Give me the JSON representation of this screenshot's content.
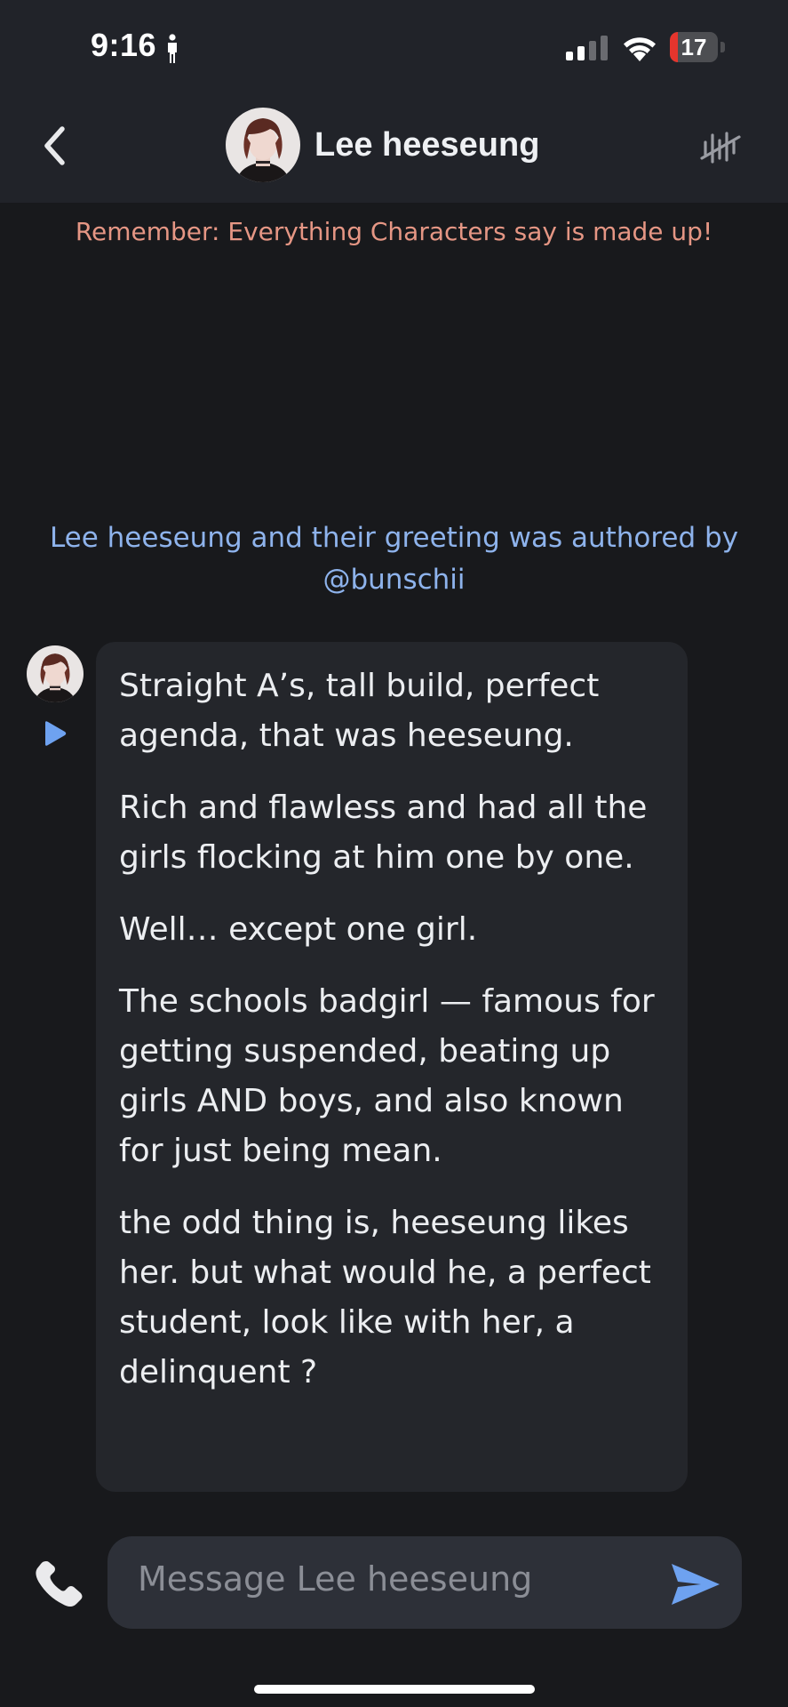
{
  "status_bar": {
    "time": "9:16",
    "battery_level": "17",
    "battery_fraction": 0.17,
    "icons": [
      "person-icon",
      "signal-icon",
      "wifi-icon",
      "battery-icon"
    ]
  },
  "header": {
    "title": "Lee heeseung",
    "icons": [
      "back-chevron-icon",
      "avatar",
      "mute-audio-icon"
    ]
  },
  "disclaimer": "Remember: Everything Characters say is made up!",
  "attribution": "Lee heeseung and their greeting was authored by @bunschii",
  "message": {
    "paragraphs": [
      "Straight A’s, tall build, perfect agenda, that was heeseung.",
      "Rich and flawless and had all the girls flocking at him one by one.",
      "Well… except one girl.",
      "The schools badgirl — famous for getting suspended, beating up girls AND boys, and also known for just being mean.",
      "the odd thing is, heeseung likes her. but what would he, a perfect student, look like with her, a delinquent ?"
    ]
  },
  "input": {
    "placeholder": "Message Lee heeseung",
    "value": ""
  },
  "colors": {
    "background": "#18191c",
    "header_background": "#212329",
    "bubble_background": "#24262b",
    "disclaimer": "#e59684",
    "attribution": "#8eb3ec",
    "accent": "#6ea2f0",
    "battery_fill": "#e5352d"
  }
}
